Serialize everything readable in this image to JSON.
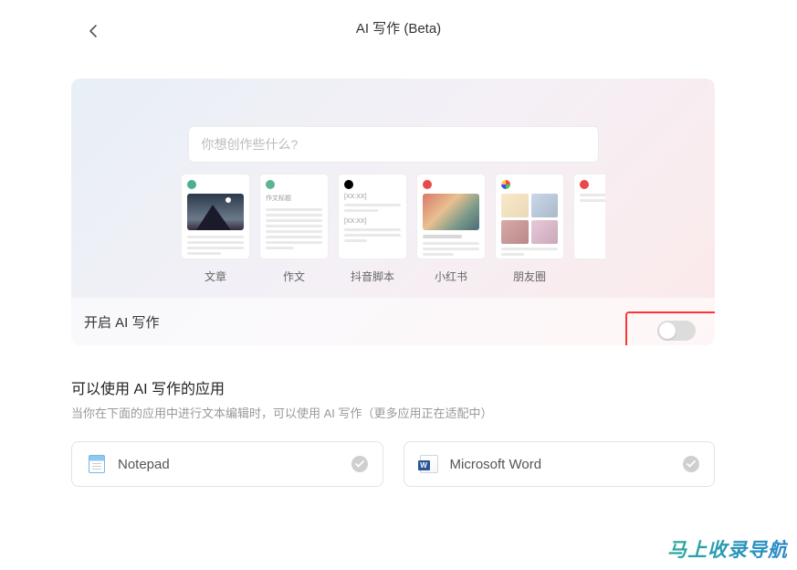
{
  "header": {
    "title": "AI 写作 (Beta)"
  },
  "card": {
    "search_placeholder": "你想创作些什么?",
    "templates": [
      {
        "label": "文章"
      },
      {
        "label": "作文",
        "sublabel": "作文标题"
      },
      {
        "label": "抖音脚本"
      },
      {
        "label": "小红书"
      },
      {
        "label": "朋友圈"
      }
    ],
    "toggle": {
      "label": "开启 AI 写作",
      "enabled": false
    }
  },
  "apps": {
    "title": "可以使用 AI 写作的应用",
    "desc": "当你在下面的应用中进行文本编辑时，可以使用 AI 写作（更多应用正在适配中）",
    "items": [
      {
        "name": "Notepad",
        "enabled": true
      },
      {
        "name": "Microsoft Word",
        "enabled": true
      }
    ]
  },
  "watermark": "马上收录导航"
}
